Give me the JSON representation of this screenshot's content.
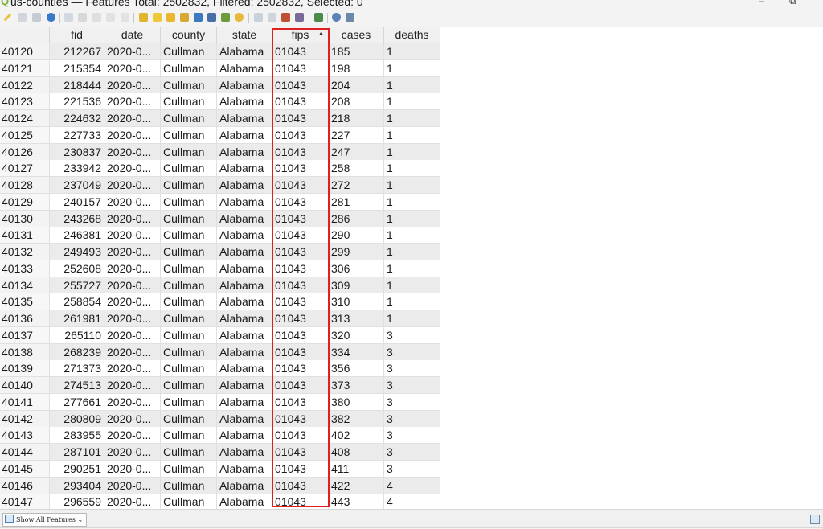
{
  "window": {
    "title": "us-counties — Features Total: 2502832, Filtered: 2502832, Selected: 0",
    "minimize_glyph": "–",
    "restore_glyph": "⧉"
  },
  "toolbar": {
    "icons": [
      "toggle-edit-icon",
      "multi-edit-icon",
      "save-edits-icon",
      "reload-icon",
      "add-feature-icon",
      "delete-feature-icon",
      "cut-icon",
      "copy-icon",
      "paste-icon",
      "select-expression-icon",
      "select-all-icon",
      "invert-selection-icon",
      "deselect-icon",
      "filter-selection-icon",
      "move-selection-top-icon",
      "pan-to-selection-icon",
      "zoom-to-selection-icon",
      "new-field-icon",
      "delete-field-icon",
      "field-calculator-icon",
      "conditional-format-icon",
      "actions-icon",
      "dock-icon",
      "table-view-icon"
    ]
  },
  "table": {
    "columns": [
      "fid",
      "date",
      "county",
      "state",
      "fips",
      "cases",
      "deaths"
    ],
    "sorted_column": "fips",
    "sort_glyph": "▲",
    "rows": [
      {
        "rownum": "40120",
        "fid": "212267",
        "date": "2020-0...",
        "county": "Cullman",
        "state": "Alabama",
        "fips": "01043",
        "cases": "185",
        "deaths": "1"
      },
      {
        "rownum": "40121",
        "fid": "215354",
        "date": "2020-0...",
        "county": "Cullman",
        "state": "Alabama",
        "fips": "01043",
        "cases": "198",
        "deaths": "1"
      },
      {
        "rownum": "40122",
        "fid": "218444",
        "date": "2020-0...",
        "county": "Cullman",
        "state": "Alabama",
        "fips": "01043",
        "cases": "204",
        "deaths": "1"
      },
      {
        "rownum": "40123",
        "fid": "221536",
        "date": "2020-0...",
        "county": "Cullman",
        "state": "Alabama",
        "fips": "01043",
        "cases": "208",
        "deaths": "1"
      },
      {
        "rownum": "40124",
        "fid": "224632",
        "date": "2020-0...",
        "county": "Cullman",
        "state": "Alabama",
        "fips": "01043",
        "cases": "218",
        "deaths": "1"
      },
      {
        "rownum": "40125",
        "fid": "227733",
        "date": "2020-0...",
        "county": "Cullman",
        "state": "Alabama",
        "fips": "01043",
        "cases": "227",
        "deaths": "1"
      },
      {
        "rownum": "40126",
        "fid": "230837",
        "date": "2020-0...",
        "county": "Cullman",
        "state": "Alabama",
        "fips": "01043",
        "cases": "247",
        "deaths": "1"
      },
      {
        "rownum": "40127",
        "fid": "233942",
        "date": "2020-0...",
        "county": "Cullman",
        "state": "Alabama",
        "fips": "01043",
        "cases": "258",
        "deaths": "1"
      },
      {
        "rownum": "40128",
        "fid": "237049",
        "date": "2020-0...",
        "county": "Cullman",
        "state": "Alabama",
        "fips": "01043",
        "cases": "272",
        "deaths": "1"
      },
      {
        "rownum": "40129",
        "fid": "240157",
        "date": "2020-0...",
        "county": "Cullman",
        "state": "Alabama",
        "fips": "01043",
        "cases": "281",
        "deaths": "1"
      },
      {
        "rownum": "40130",
        "fid": "243268",
        "date": "2020-0...",
        "county": "Cullman",
        "state": "Alabama",
        "fips": "01043",
        "cases": "286",
        "deaths": "1"
      },
      {
        "rownum": "40131",
        "fid": "246381",
        "date": "2020-0...",
        "county": "Cullman",
        "state": "Alabama",
        "fips": "01043",
        "cases": "290",
        "deaths": "1"
      },
      {
        "rownum": "40132",
        "fid": "249493",
        "date": "2020-0...",
        "county": "Cullman",
        "state": "Alabama",
        "fips": "01043",
        "cases": "299",
        "deaths": "1"
      },
      {
        "rownum": "40133",
        "fid": "252608",
        "date": "2020-0...",
        "county": "Cullman",
        "state": "Alabama",
        "fips": "01043",
        "cases": "306",
        "deaths": "1"
      },
      {
        "rownum": "40134",
        "fid": "255727",
        "date": "2020-0...",
        "county": "Cullman",
        "state": "Alabama",
        "fips": "01043",
        "cases": "309",
        "deaths": "1"
      },
      {
        "rownum": "40135",
        "fid": "258854",
        "date": "2020-0...",
        "county": "Cullman",
        "state": "Alabama",
        "fips": "01043",
        "cases": "310",
        "deaths": "1"
      },
      {
        "rownum": "40136",
        "fid": "261981",
        "date": "2020-0...",
        "county": "Cullman",
        "state": "Alabama",
        "fips": "01043",
        "cases": "313",
        "deaths": "1"
      },
      {
        "rownum": "40137",
        "fid": "265110",
        "date": "2020-0...",
        "county": "Cullman",
        "state": "Alabama",
        "fips": "01043",
        "cases": "320",
        "deaths": "3"
      },
      {
        "rownum": "40138",
        "fid": "268239",
        "date": "2020-0...",
        "county": "Cullman",
        "state": "Alabama",
        "fips": "01043",
        "cases": "334",
        "deaths": "3"
      },
      {
        "rownum": "40139",
        "fid": "271373",
        "date": "2020-0...",
        "county": "Cullman",
        "state": "Alabama",
        "fips": "01043",
        "cases": "356",
        "deaths": "3"
      },
      {
        "rownum": "40140",
        "fid": "274513",
        "date": "2020-0...",
        "county": "Cullman",
        "state": "Alabama",
        "fips": "01043",
        "cases": "373",
        "deaths": "3"
      },
      {
        "rownum": "40141",
        "fid": "277661",
        "date": "2020-0...",
        "county": "Cullman",
        "state": "Alabama",
        "fips": "01043",
        "cases": "380",
        "deaths": "3"
      },
      {
        "rownum": "40142",
        "fid": "280809",
        "date": "2020-0...",
        "county": "Cullman",
        "state": "Alabama",
        "fips": "01043",
        "cases": "382",
        "deaths": "3"
      },
      {
        "rownum": "40143",
        "fid": "283955",
        "date": "2020-0...",
        "county": "Cullman",
        "state": "Alabama",
        "fips": "01043",
        "cases": "402",
        "deaths": "3"
      },
      {
        "rownum": "40144",
        "fid": "287101",
        "date": "2020-0...",
        "county": "Cullman",
        "state": "Alabama",
        "fips": "01043",
        "cases": "408",
        "deaths": "3"
      },
      {
        "rownum": "40145",
        "fid": "290251",
        "date": "2020-0...",
        "county": "Cullman",
        "state": "Alabama",
        "fips": "01043",
        "cases": "411",
        "deaths": "3"
      },
      {
        "rownum": "40146",
        "fid": "293404",
        "date": "2020-0...",
        "county": "Cullman",
        "state": "Alabama",
        "fips": "01043",
        "cases": "422",
        "deaths": "4"
      },
      {
        "rownum": "40147",
        "fid": "296559",
        "date": "2020-0...",
        "county": "Cullman",
        "state": "Alabama",
        "fips": "01043",
        "cases": "443",
        "deaths": "4"
      }
    ]
  },
  "statusbar": {
    "filter_button_label": "Show All Features",
    "dropdown_glyph": "⌄"
  },
  "colors": {
    "highlight_box": "#e02020",
    "alt_row": "#ebebeb",
    "app_icon": "#7bb133"
  }
}
